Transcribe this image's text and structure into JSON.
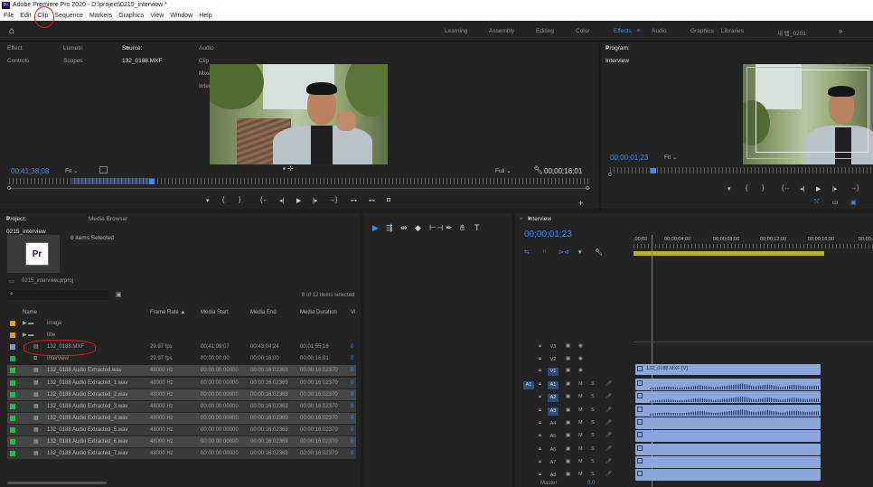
{
  "title": "Adobe Premiere Pro 2020 - D:\\project\\0215_interview *",
  "app_icon": "Pr",
  "menu": [
    "File",
    "Edit",
    "Clip",
    "Sequence",
    "Markers",
    "Graphics",
    "View",
    "Window",
    "Help"
  ],
  "workspaces": {
    "items": [
      "Learning",
      "Assembly",
      "Editing",
      "Color",
      "Effects",
      "Audio",
      "Graphics",
      "Libraries",
      "새 탭_0201"
    ],
    "active": "Effects",
    "active_suffix": "≡"
  },
  "source_panel": {
    "tabs": [
      "Effect Controls",
      "Lumetri Scopes",
      "Source: 132_0188.MXF",
      "Audio Clip Mixer: Interview"
    ],
    "active_suffix": "≡",
    "timecode_left": "00;41;38;08",
    "fit": "Fit",
    "fit_right": "Full",
    "timecode_right": "00;00;16;01"
  },
  "program_panel": {
    "title": "Program: Interview",
    "title_suffix": "≡",
    "timecode": "00;00;01;23",
    "fit": "Fit"
  },
  "project_panel": {
    "tabs": [
      "Project: 0215_interview",
      "Media Browser"
    ],
    "tab_suffix": "≡",
    "selection": "8 items Selected",
    "thumb_label": "Pr",
    "project_file": "0215_interview.prproj",
    "items_count": "8 of 12 items selected",
    "columns": [
      "Name",
      "Frame Rate",
      "Media Start",
      "Media End",
      "Media Duration",
      "Vi"
    ],
    "sort_arrow": "▲",
    "rows": [
      {
        "name": "image",
        "type": "bin",
        "color": "#e89a2c",
        "fr": "",
        "ms": "",
        "me": "",
        "md": "",
        "state": "none"
      },
      {
        "name": "title",
        "type": "bin",
        "color": "#e89a2c",
        "fr": "",
        "ms": "",
        "me": "",
        "md": "",
        "state": "none"
      },
      {
        "name": "132_0188.MXF",
        "type": "clip",
        "color": "#7f97d4",
        "fr": "29.97 fps",
        "ms": "00;41;09;07",
        "me": "00;43;04;24",
        "md": "00;01;55;16",
        "state": "none"
      },
      {
        "name": "Interview",
        "type": "seq",
        "color": "#2aa84a",
        "fr": "29.97 fps",
        "ms": "00;00;00;00",
        "me": "00;00;16;00",
        "md": "00;00;16;01",
        "state": "none"
      },
      {
        "name": "132_0188 Audio Extracted.wav",
        "type": "audio",
        "color": "#2ab84a",
        "fr": "48000 Hz",
        "ms": "00:00:00:00000",
        "me": "00:00:16:02369",
        "md": "00:00:16:02370",
        "state": "sel"
      },
      {
        "name": "132_0188 Audio Extracted_1.wav",
        "type": "audio",
        "color": "#2ab84a",
        "fr": "48000 Hz",
        "ms": "00:00:00:00000",
        "me": "00:00:16:02369",
        "md": "00:00:16:02370",
        "state": "dim"
      },
      {
        "name": "132_0188 Audio Extracted_2.wav",
        "type": "audio",
        "color": "#2ab84a",
        "fr": "48000 Hz",
        "ms": "00:00:00:00000",
        "me": "00:00:16:02369",
        "md": "00:00:16:02370",
        "state": "sel"
      },
      {
        "name": "132_0188 Audio Extracted_3.wav",
        "type": "audio",
        "color": "#2ab84a",
        "fr": "48000 Hz",
        "ms": "00:00:00:00000",
        "me": "00:00:16:02369",
        "md": "00:00:16:02370",
        "state": "dim"
      },
      {
        "name": "132_0188 Audio Extracted_4.wav",
        "type": "audio",
        "color": "#2ab84a",
        "fr": "48000 Hz",
        "ms": "00:00:00:00000",
        "me": "00:00:16:02369",
        "md": "00:00:16:02370",
        "state": "sel"
      },
      {
        "name": "132_0188 Audio Extracted_5.wav",
        "type": "audio",
        "color": "#2ab84a",
        "fr": "48000 Hz",
        "ms": "00:00:00:00000",
        "me": "00:00:16:02369",
        "md": "00:00:16:02370",
        "state": "dim"
      },
      {
        "name": "132_0188 Audio Extracted_6.wav",
        "type": "audio",
        "color": "#2ab84a",
        "fr": "48000 Hz",
        "ms": "00:00:00:00000",
        "me": "00:00:16:02369",
        "md": "00:00:16:02370",
        "state": "sel"
      },
      {
        "name": "132_0188 Audio Extracted_7.wav",
        "type": "audio",
        "color": "#2ab84a",
        "fr": "48000 Hz",
        "ms": "00:00:00:00000",
        "me": "00:00:16:02369",
        "md": "00:00:16:02370",
        "state": "dim"
      }
    ]
  },
  "timeline": {
    "title": "Interview",
    "title_suffix": "≡",
    "timecode": "00;00;01;23",
    "ruler": [
      ";00;00",
      "00;00;04;00",
      "00;00;08;00",
      "00;00;12;00",
      "00;00;16;00",
      "00;00;2"
    ],
    "tracks": [
      {
        "id": "V3",
        "kind": "video"
      },
      {
        "id": "V2",
        "kind": "video"
      },
      {
        "id": "V1",
        "kind": "video",
        "target": true
      },
      {
        "id": "A1",
        "kind": "audio",
        "target": true,
        "source": "A1"
      },
      {
        "id": "A2",
        "kind": "audio",
        "target": true
      },
      {
        "id": "A3",
        "kind": "audio",
        "target": true
      },
      {
        "id": "A4",
        "kind": "audio"
      },
      {
        "id": "A5",
        "kind": "audio"
      },
      {
        "id": "A6",
        "kind": "audio"
      },
      {
        "id": "A7",
        "kind": "audio"
      },
      {
        "id": "A8",
        "kind": "audio"
      }
    ],
    "mute": "M",
    "solo": "S",
    "clip_v1": "132_0188.MXF [V]",
    "master": "Master",
    "master_value": "0.0"
  },
  "colors": {
    "accent": "#3d8cf0",
    "annotation": "#e01b1b"
  }
}
